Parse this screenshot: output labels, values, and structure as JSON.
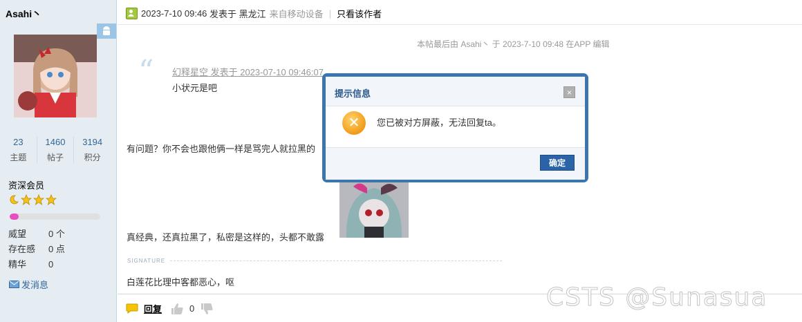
{
  "user": {
    "name": "Asahi丶",
    "stats": [
      {
        "value": "23",
        "label": "主题"
      },
      {
        "value": "1460",
        "label": "帖子"
      },
      {
        "value": "3194",
        "label": "积分"
      }
    ],
    "rank": "资深会员",
    "level_progress": 0.1,
    "profile": [
      {
        "key": "威望",
        "value": "0 个"
      },
      {
        "key": "存在感",
        "value": "0 点"
      },
      {
        "key": "精华",
        "value": "0"
      }
    ],
    "send_message": "发消息"
  },
  "post": {
    "date": "2023-7-10 09:46",
    "posted_in": "发表于 黑龙江",
    "device": "来自移动设备",
    "only_author": "只看该作者",
    "edited_note": "本帖最后由 Asahi丶 于 2023-7-10 09:48 在APP 编辑",
    "quote": {
      "author_line": "幻释星空 发表于 2023-07-10 09:46:07",
      "text": "小状元是吧"
    },
    "body_line1": "有问题？你不会也跟他俩一样是骂完人就拉黑的",
    "body_line2": "真经典，还真拉黑了，私密是这样的，头都不敢露",
    "signature_label": "SIGNATURE",
    "signature": "白莲花比理中客都恶心，呕",
    "reply": "回复",
    "like_count": "0"
  },
  "dialog": {
    "title": "提示信息",
    "message": "您已被对方屏蔽，无法回复ta。",
    "ok": "确定",
    "close": "×"
  },
  "watermark": "CSTS @Sunasua"
}
